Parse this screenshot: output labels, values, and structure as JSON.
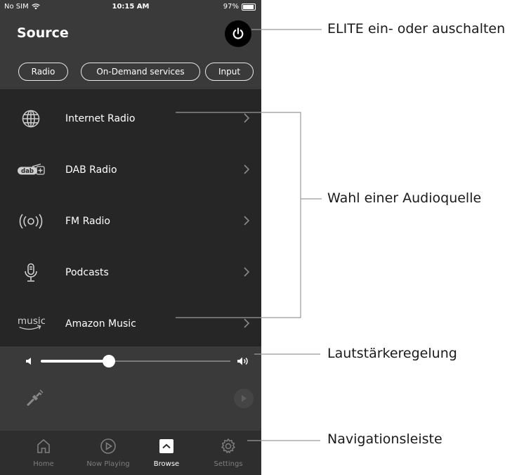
{
  "status_bar": {
    "carrier": "No SIM",
    "time": "10:15 AM",
    "battery": "97%",
    "battery_level": 0.97
  },
  "header": {
    "title": "Source"
  },
  "source_tabs": [
    "Radio",
    "On-Demand services",
    "Input"
  ],
  "sources": [
    {
      "label": "Internet Radio",
      "icon": "globe-icon"
    },
    {
      "label": "DAB Radio",
      "icon": "dab-plus-icon"
    },
    {
      "label": "FM Radio",
      "icon": "fm-broadcast-icon"
    },
    {
      "label": "Podcasts",
      "icon": "microphone-icon"
    },
    {
      "label": "Amazon Music",
      "icon": "amazon-music-logo"
    }
  ],
  "volume": {
    "level": 0.36
  },
  "nav": [
    {
      "label": "Home",
      "icon": "home-icon",
      "active": false
    },
    {
      "label": "Now Playing",
      "icon": "play-circle-icon",
      "active": false
    },
    {
      "label": "Browse",
      "icon": "browse-icon",
      "active": true
    },
    {
      "label": "Settings",
      "icon": "gear-icon",
      "active": false
    }
  ],
  "annotations": {
    "power": "ELITE ein- oder auschalten",
    "source_select": "Wahl einer Audioquelle",
    "volume": "Lautstärkeregelung",
    "navigation": "Navigationsleiste"
  },
  "colors": {
    "line": "#9a9a9a",
    "accent_white": "#ffffff"
  }
}
